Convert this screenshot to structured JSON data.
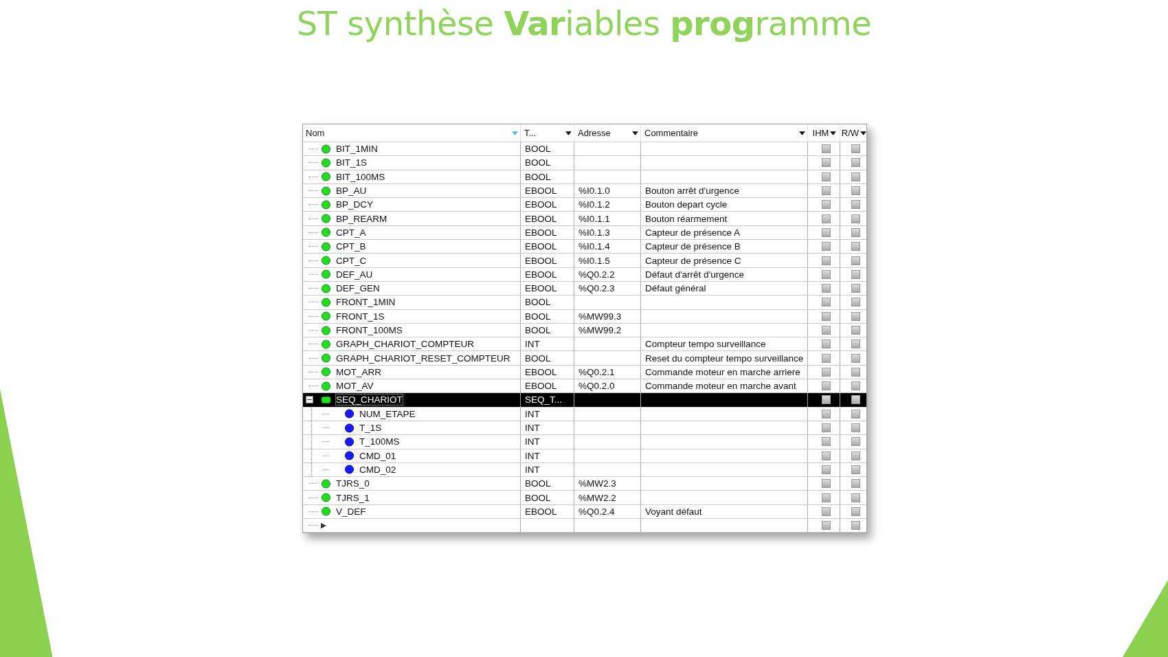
{
  "title": "ST synthèse **Var**iables **prog**ramme",
  "table": {
    "columns": [
      {
        "label": "Nom",
        "sort": true
      },
      {
        "label": "T...",
        "sort": false
      },
      {
        "label": "Adresse",
        "sort": false
      },
      {
        "label": "Commentaire",
        "sort": false
      },
      {
        "label": "IHM",
        "sort": false
      },
      {
        "label": "R/W",
        "sort": false
      }
    ],
    "rows": [
      {
        "kind": "variable",
        "name": "BIT_1MIN",
        "type": "BOOL",
        "ihm": false,
        "rw": false,
        "selected": false
      },
      {
        "kind": "variable",
        "name": "BIT_1S",
        "type": "BOOL",
        "ihm": false,
        "rw": false,
        "selected": false
      },
      {
        "kind": "variable",
        "name": "BIT_100MS",
        "type": "BOOL",
        "ihm": false,
        "rw": false,
        "selected": false
      },
      {
        "kind": "variable",
        "name": "BP_AU",
        "type": "EBOOL",
        "address": "%I0.1.0",
        "comment": "Bouton arrêt d'urgence",
        "ihm": false,
        "rw": false,
        "selected": false
      },
      {
        "kind": "variable",
        "name": "BP_DCY",
        "type": "EBOOL",
        "address": "%I0.1.2",
        "comment": "Bouton depart cycle",
        "ihm": false,
        "rw": false,
        "selected": false
      },
      {
        "kind": "variable",
        "name": "BP_REARM",
        "type": "EBOOL",
        "address": "%I0.1.1",
        "comment": "Bouton réarmement",
        "ihm": false,
        "rw": false,
        "selected": false
      },
      {
        "kind": "variable",
        "name": "CPT_A",
        "type": "EBOOL",
        "address": "%I0.1.3",
        "comment": "Capteur de présence A",
        "ihm": false,
        "rw": false,
        "selected": false
      },
      {
        "kind": "variable",
        "name": "CPT_B",
        "type": "EBOOL",
        "address": "%I0.1.4",
        "comment": "Capteur de présence B",
        "ihm": false,
        "rw": false,
        "selected": false
      },
      {
        "kind": "variable",
        "name": "CPT_C",
        "type": "EBOOL",
        "address": "%I0.1.5",
        "comment": "Capteur de présence C",
        "ihm": false,
        "rw": false,
        "selected": false
      },
      {
        "kind": "variable",
        "name": "DEF_AU",
        "type": "EBOOL",
        "address": "%Q0.2.2",
        "comment": "Défaut d'arrêt d'urgence",
        "ihm": false,
        "rw": false,
        "selected": false
      },
      {
        "kind": "variable",
        "name": "DEF_GEN",
        "type": "EBOOL",
        "address": "%Q0.2.3",
        "comment": "Défaut général",
        "ihm": false,
        "rw": false,
        "selected": false
      },
      {
        "kind": "variable",
        "name": "FRONT_1MIN",
        "type": "BOOL",
        "ihm": false,
        "rw": false,
        "selected": false
      },
      {
        "kind": "variable",
        "name": "FRONT_1S",
        "type": "BOOL",
        "address": "%MW99.3",
        "ihm": false,
        "rw": false,
        "selected": false
      },
      {
        "kind": "variable",
        "name": "FRONT_100MS",
        "type": "BOOL",
        "address": "%MW99.2",
        "ihm": false,
        "rw": false,
        "selected": false
      },
      {
        "kind": "variable",
        "name": "GRAPH_CHARIOT_COMPTEUR",
        "type": "INT",
        "comment": "Compteur tempo surveillance",
        "ihm": false,
        "rw": false,
        "selected": false
      },
      {
        "kind": "variable",
        "name": "GRAPH_CHARIOT_RESET_COMPTEUR",
        "type": "BOOL",
        "comment": "Reset du compteur tempo surveillance",
        "ihm": false,
        "rw": false,
        "selected": false
      },
      {
        "kind": "variable",
        "name": "MOT_ARR",
        "type": "EBOOL",
        "address": "%Q0.2.1",
        "comment": "Commande moteur en marche arriere",
        "ihm": false,
        "rw": false,
        "selected": false
      },
      {
        "kind": "variable",
        "name": "MOT_AV",
        "type": "EBOOL",
        "address": "%Q0.2.0",
        "comment": "Commande moteur en marche avant",
        "ihm": false,
        "rw": false,
        "selected": false
      },
      {
        "kind": "structure",
        "name": "SEQ_CHARIOT",
        "type": "SEQ_T...",
        "ihm": false,
        "rw": false,
        "selected": true,
        "expanded": true,
        "children": [
          {
            "kind": "member",
            "name": "NUM_ETAPE",
            "type": "INT",
            "ihm": false,
            "rw": false,
            "selected": false
          },
          {
            "kind": "member",
            "name": "T_1S",
            "type": "INT",
            "ihm": false,
            "rw": false,
            "selected": false
          },
          {
            "kind": "member",
            "name": "T_100MS",
            "type": "INT",
            "ihm": false,
            "rw": false,
            "selected": false
          },
          {
            "kind": "member",
            "name": "CMD_01",
            "type": "INT",
            "ihm": false,
            "rw": false,
            "selected": false
          },
          {
            "kind": "member",
            "name": "CMD_02",
            "type": "INT",
            "ihm": false,
            "rw": false,
            "selected": false
          }
        ]
      },
      {
        "kind": "variable",
        "name": "TJRS_0",
        "type": "BOOL",
        "address": "%MW2.3",
        "ihm": false,
        "rw": false,
        "selected": false
      },
      {
        "kind": "variable",
        "name": "TJRS_1",
        "type": "BOOL",
        "address": "%MW2.2",
        "ihm": false,
        "rw": false,
        "selected": false
      },
      {
        "kind": "variable",
        "name": "V_DEF",
        "type": "EBOOL",
        "address": "%Q0.2.4",
        "comment": "Voyant défaut",
        "ihm": false,
        "rw": false,
        "selected": false
      },
      {
        "kind": "new",
        "ihm": false,
        "rw": false,
        "selected": false
      }
    ]
  }
}
